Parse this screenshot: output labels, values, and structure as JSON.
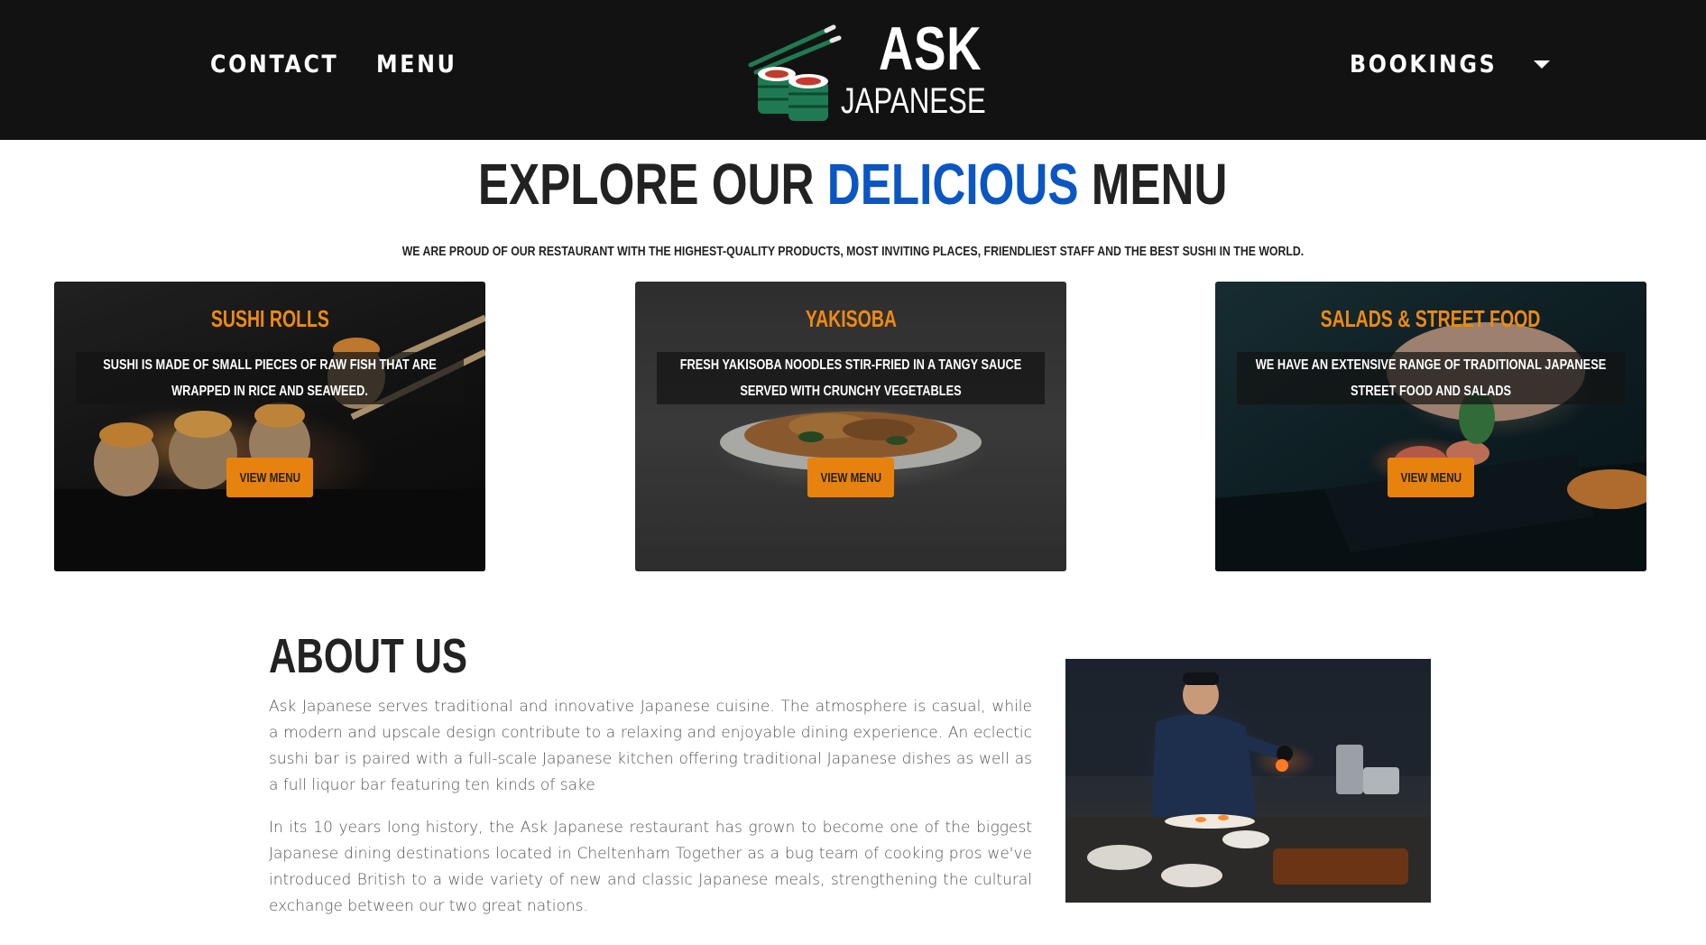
{
  "nav": {
    "left_links": [
      "CONTACT",
      "MENU"
    ],
    "right_link": "BOOKINGS",
    "logo": {
      "line1": "ASK",
      "line2": "JAPANESE"
    }
  },
  "hero": {
    "title_part1": "EXPLORE OUR ",
    "title_accent": "DELICIOUS",
    "title_part2": " MENU",
    "subtitle": "WE ARE PROUD OF OUR RESTAURANT WITH THE HIGHEST-QUALITY PRODUCTS, MOST INVITING PLACES, FRIENDLIEST STAFF AND THE BEST SUSHI IN THE WORLD."
  },
  "cards": [
    {
      "title": "SUSHI ROLLS",
      "description": "SUSHI IS MADE OF SMALL PIECES OF RAW FISH THAT ARE WRAPPED IN RICE AND SEAWEED.",
      "button": "VIEW MENU"
    },
    {
      "title": "YAKISOBA",
      "description": "FRESH YAKISOBA NOODLES STIR-FRIED IN A TANGY SAUCE SERVED WITH CRUNCHY VEGETABLES",
      "button": "VIEW MENU"
    },
    {
      "title": "SALADS & STREET FOOD",
      "description": "WE HAVE AN EXTENSIVE RANGE OF TRADITIONAL JAPANESE STREET FOOD AND SALADS",
      "button": "VIEW MENU"
    }
  ],
  "about": {
    "title": "ABOUT US",
    "paragraphs": [
      "Ask Japanese serves traditional and innovative Japanese cuisine. The atmosphere is casual, while a modern and upscale design contribute to a relaxing and enjoyable dining experience. An eclectic sushi bar is paired with a full-scale Japanese kitchen offering traditional Japanese dishes as well as a full liquor bar featuring ten kinds of sake",
      "In its 10 years long history, the Ask Japanese restaurant has grown to become one of the biggest Japanese dining destinations located in Cheltenham Together as a bug team of cooking pros we've introduced British to a wide variety of new and classic Japanese meals, strengthening the cultural exchange between our two great nations."
    ]
  },
  "colors": {
    "nav_background": "#121212",
    "accent_blue": "#0a56c2",
    "card_title_orange": "#f08a12",
    "button_orange": "#e8820e",
    "logo_green": "#1f7a52"
  },
  "icons": {
    "logo": "sushi-chopsticks-icon",
    "bookings_dropdown": "caret-down-icon"
  }
}
